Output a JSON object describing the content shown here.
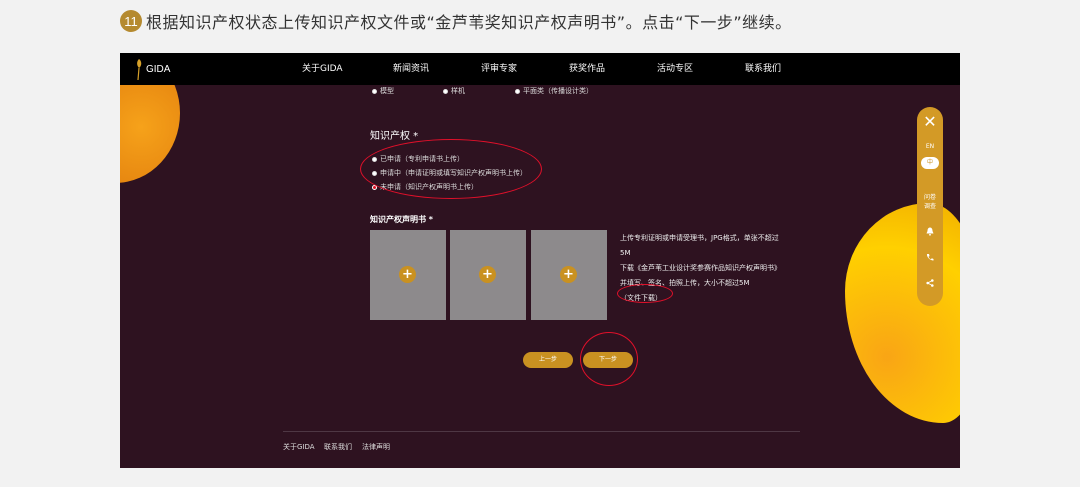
{
  "instruction": {
    "step_number": "11",
    "text": "根据知识产权状态上传知识产权文件或“金芦苇奖知识产权声明书”。点击“下一步”继续。"
  },
  "nav": {
    "logo_text": "GIDA",
    "items": [
      "关于GIDA",
      "新闻资讯",
      "评审专家",
      "获奖作品",
      "活动专区",
      "联系我们"
    ]
  },
  "category_row": {
    "options": [
      "模型",
      "样机",
      "平面类（传播设计类）"
    ]
  },
  "ip_section": {
    "title": "知识产权 *",
    "options": [
      "已申请（专利申请书上传）",
      "申请中（申请证明或填写知识产权声明书上传）",
      "未申请（知识产权声明书上传）"
    ]
  },
  "statement_section": {
    "title": "知识产权声明书 *",
    "upload_plus": "+",
    "hint_lines": [
      "上传专利证明或申请受理书，JPG格式，单张不超过",
      "5M",
      "下载《金芦苇工业设计奖参赛作品知识产权声明书》",
      "并填写、签名、拍照上传，大小不超过5M"
    ],
    "download_link": "（文件下载）"
  },
  "buttons": {
    "prev": "上一步",
    "next": "下一步"
  },
  "footer": {
    "items": [
      "关于GIDA",
      "联系我们",
      "法律声明"
    ]
  },
  "toolbar": {
    "close": "✕",
    "lang_en": "EN",
    "lang_zh": "中",
    "survey": [
      "问卷",
      "调查"
    ]
  },
  "colors": {
    "page_bg": "#f2f2f2",
    "frame_bg": "#2e1220",
    "nav_bg": "#000000",
    "accent_gold": "#c99121",
    "annotation_red": "#e0102a"
  }
}
